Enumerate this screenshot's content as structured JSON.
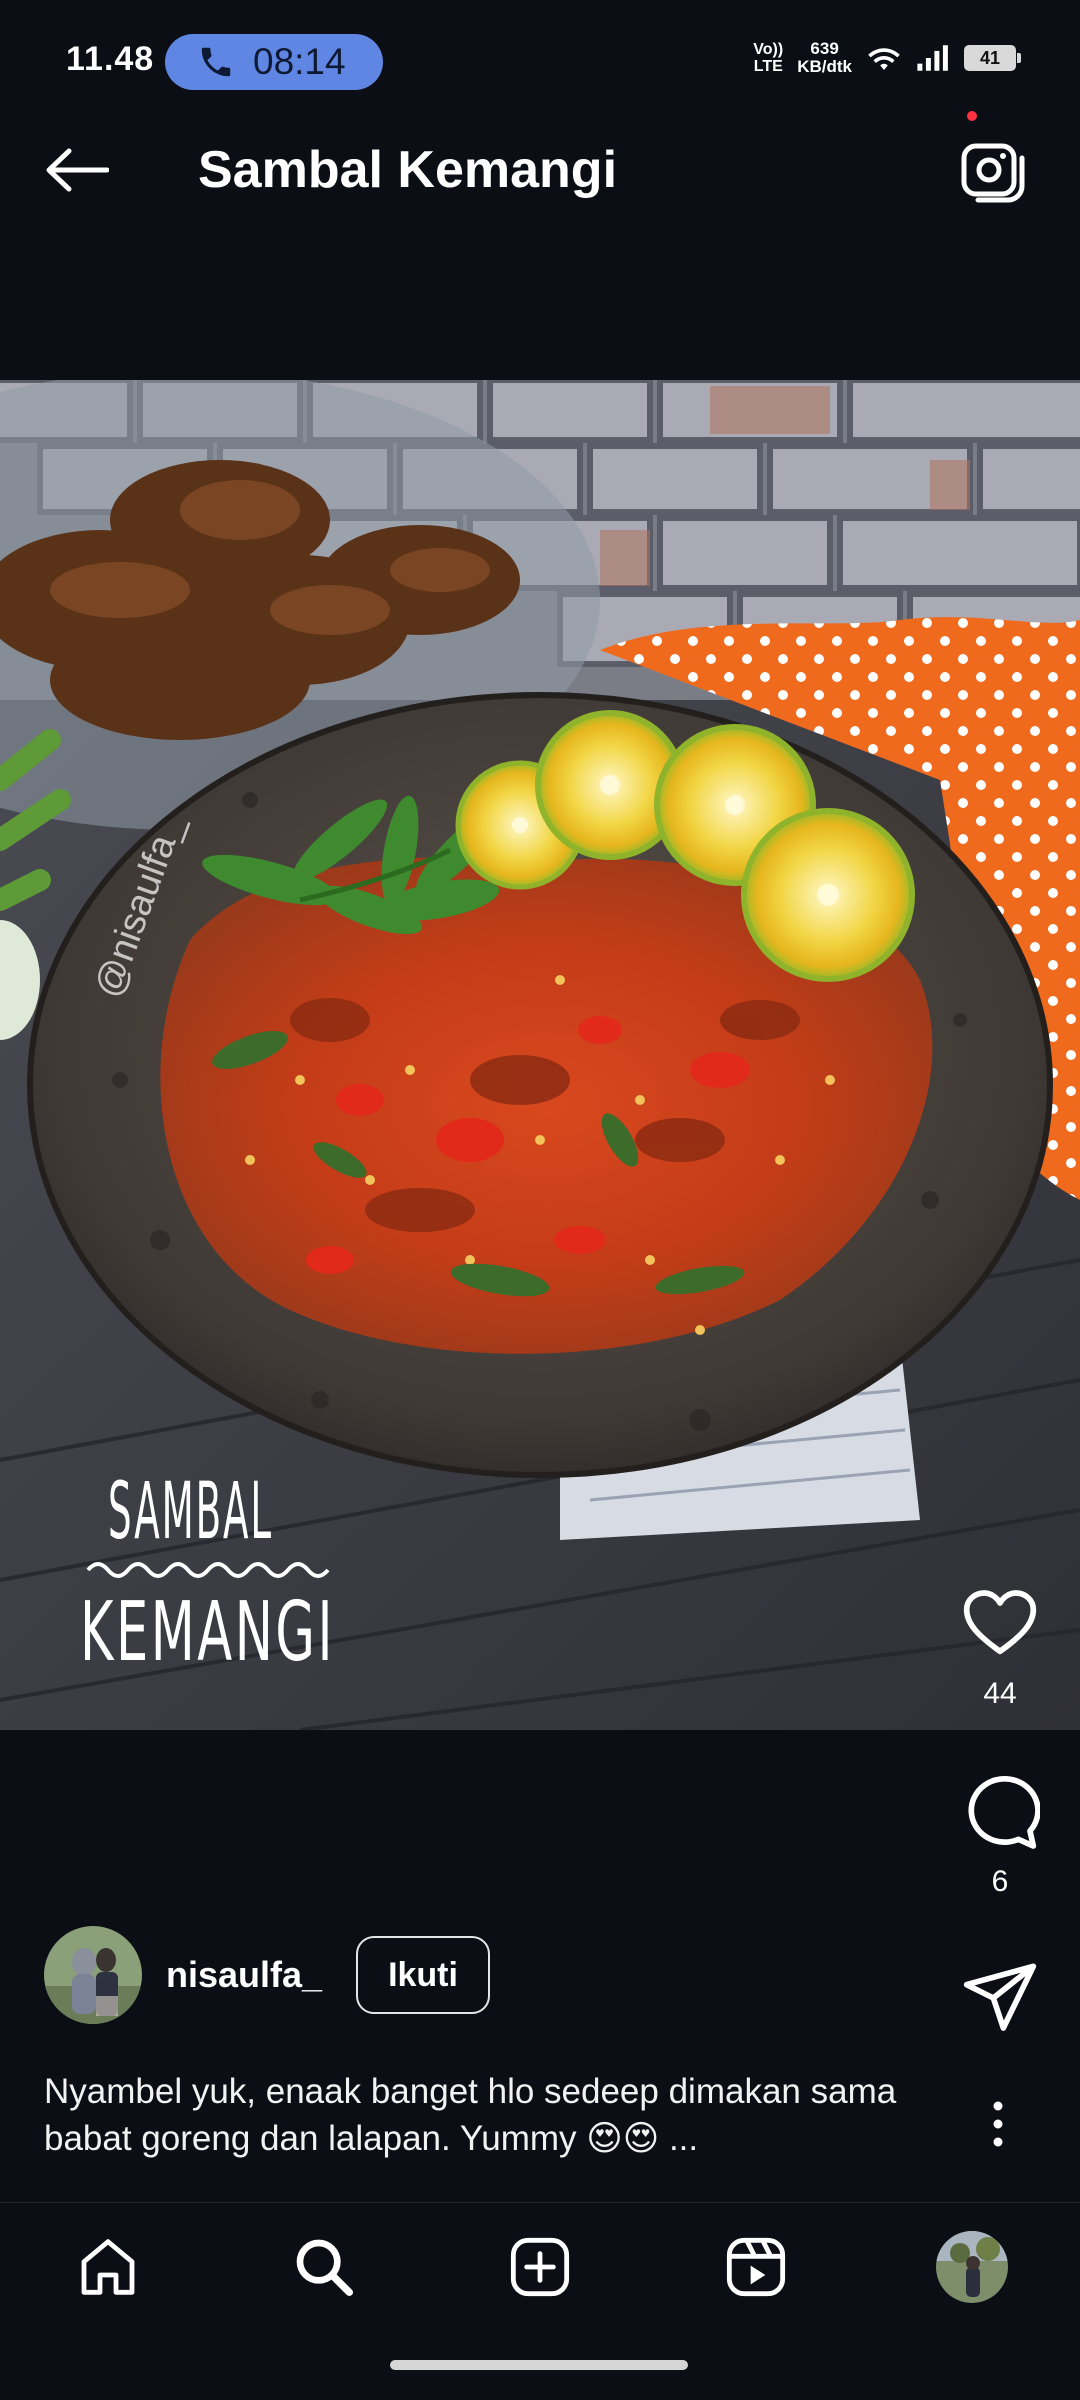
{
  "status_bar": {
    "time": "11.48",
    "call_time": "08:14",
    "volte_top": "Vo))",
    "volte_bottom": "LTE",
    "speed_value": "639",
    "speed_unit": "KB/dtk",
    "battery": "41"
  },
  "header": {
    "title": "Sambal Kemangi"
  },
  "post": {
    "watermark_handle": "@nisaulfa_",
    "overlay_title_top": "SAMBAL",
    "overlay_title_bottom": "KEMANGI"
  },
  "actions": {
    "likes": "44",
    "comments": "6"
  },
  "author": {
    "username": "nisaulfa_",
    "follow_label": "Ikuti"
  },
  "caption": {
    "text": "Nyambel yuk, enaak banget hlo sedeep dimakan sama babat goreng dan lalapan. Yummy 😍😍 ..."
  },
  "icons": {
    "back": "arrow-left-icon",
    "camera": "camera-icon",
    "like": "heart-icon",
    "comment": "comment-icon",
    "share": "send-icon",
    "more": "more-vertical-icon",
    "home": "home-icon",
    "search": "search-icon",
    "create": "add-post-icon",
    "reels": "reels-icon"
  },
  "colors": {
    "background": "#0b0f15",
    "call_pill": "#5f86e2",
    "notification_dot": "#ff3040"
  }
}
